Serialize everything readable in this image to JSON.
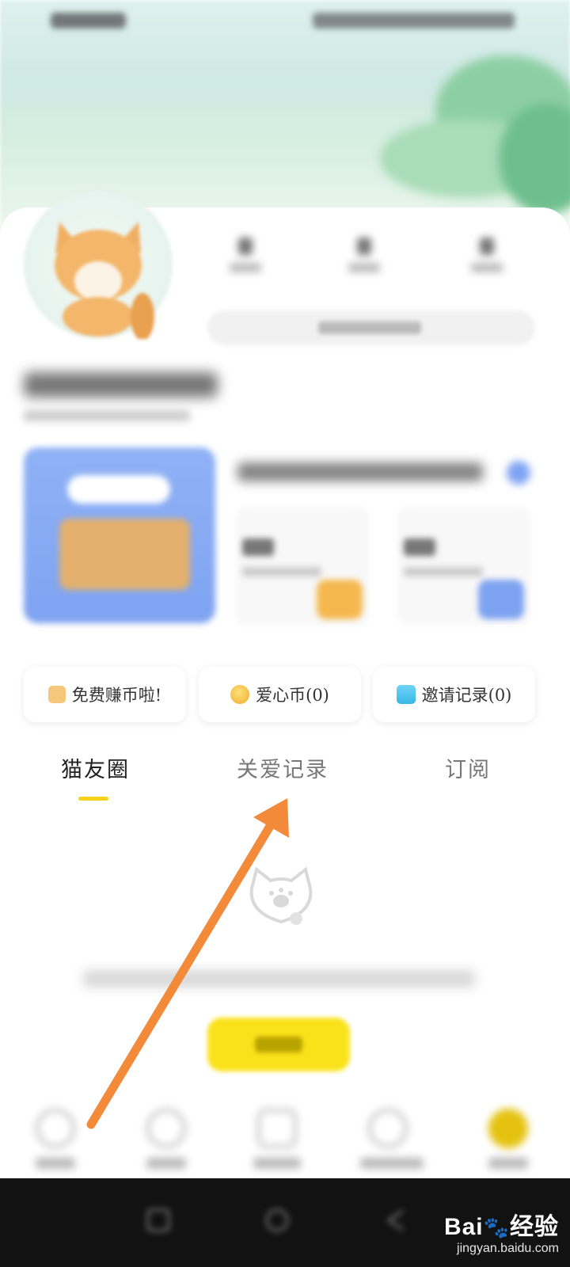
{
  "actions": {
    "earn_label": "免费赚币啦!",
    "coin_label": "爱心币(0)",
    "invite_label": "邀请记录(0)"
  },
  "tabs": [
    {
      "label": "猫友圈",
      "active": true
    },
    {
      "label": "关爱记录",
      "active": false
    },
    {
      "label": "订阅",
      "active": false
    }
  ],
  "watermark": {
    "brand": "Bai",
    "brand_cn": "经验",
    "url": "jingyan.baidu.com"
  },
  "colors": {
    "accent": "#f6d31a",
    "arrow": "#f28a3a",
    "promo_blue": "#7ea3f1"
  },
  "icons": {
    "earn": "gift-icon",
    "coin": "coin-icon",
    "invite": "box-icon"
  }
}
